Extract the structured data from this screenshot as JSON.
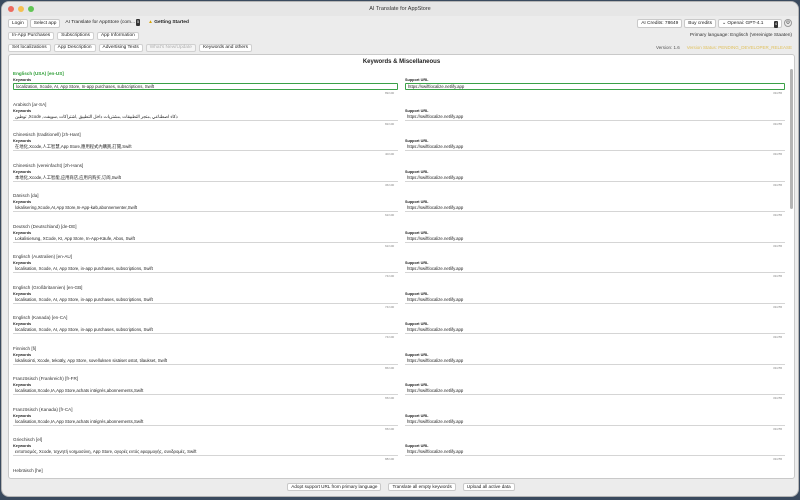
{
  "window": {
    "title": "AI Translate for AppStore"
  },
  "colors": {
    "close": "#ec6a5e",
    "minimize": "#f5bf4f",
    "zoom": "#61c554",
    "accent_green": "#2e9e36",
    "warn": "#e0c05c"
  },
  "toolbar": {
    "login_label": "Login",
    "select_app_label": "Select app",
    "app_name": "AI Translate for AppStore (com...",
    "app_badge": "5",
    "getting_started_label": "Getting Started",
    "credits": "AI Credits: 78649",
    "buy_credits_label": "Buy credits",
    "model_select": "Openai: GPT-4.1",
    "model_badge": "4"
  },
  "segments": {
    "items": [
      "In-App Purchases",
      "Subscriptions",
      "App Information"
    ],
    "primary_language": "Primary language: Englisch (Vereinigte Staaten)"
  },
  "tabs": {
    "items": [
      "Set localizations",
      "App Description",
      "Advertising Texts",
      "What's New/Update",
      "Keywords and others"
    ],
    "version": "Version: 1.6",
    "status": "Version Status: PENDING_DEVELOPER_RELEASE"
  },
  "main": {
    "title": "Keywords & Miscellaneous",
    "keywords_label": "Keywords",
    "support_label": "Support URL",
    "entries": [
      {
        "lang": "Englisch (USA) [en-US]",
        "keywords": "localization, Xcode, AI, App Store, In-app purchases, subscriptions, Swift",
        "kw_count": "89/100",
        "url": "https://swiftlocalize.netlify.app",
        "url_count": "33/255"
      },
      {
        "lang": "Arabisch [ar-SA]",
        "keywords": "توطين ,Xcode ,ذكاء اصطناعي ,متجر التطبيقات ,مشتريات داخل التطبيق ,اشتراكات ,سويفت",
        "kw_count": "82/100",
        "url": "https://swiftlocalize.netlify.app",
        "url_count": "33/255"
      },
      {
        "lang": "Chinesisch (traditionell) [zh-Hant]",
        "keywords": "在地化,Xcode,人工智慧,App Store,應用程式內購買,訂閱,Swift",
        "kw_count": "40/100",
        "url": "https://swiftlocalize.netlify.app",
        "url_count": "33/255"
      },
      {
        "lang": "Chinesisch (vereinfacht) [zh-Hans]",
        "keywords": "本地化,Xcode,人工智能,应用商店,应用内购买,订阅,Swift",
        "kw_count": "36/100",
        "url": "https://swiftlocalize.netlify.app",
        "url_count": "33/255"
      },
      {
        "lang": "Dänisch [da]",
        "keywords": "lokalisering,Xcode,AI,App Store,In-App-køb,abonnementer,Swift",
        "kw_count": "62/100",
        "url": "https://swiftlocalize.netlify.app",
        "url_count": "33/255"
      },
      {
        "lang": "Deutsch (Deutschland) [de-DE]",
        "keywords": "Lokalisierung, XCode, KI, App Store, In-App-Käufe, Abos, Swift",
        "kw_count": "62/100",
        "url": "https://swiftlocalize.netlify.app",
        "url_count": "33/255"
      },
      {
        "lang": "Englisch (Australien) [en-AU]",
        "keywords": "localisation, Xcode, AI, App Store, in-app purchases, subscriptions, Swift",
        "kw_count": "74/100",
        "url": "https://swiftlocalize.netlify.app",
        "url_count": "33/255"
      },
      {
        "lang": "Englisch (Großbritannien) [en-GB]",
        "keywords": "localisation, Xcode, AI, App Store, in-app purchases, subscriptions, Swift",
        "kw_count": "74/100",
        "url": "https://swiftlocalize.netlify.app",
        "url_count": "33/255"
      },
      {
        "lang": "Englisch (Kanada) [en-CA]",
        "keywords": "localization, Xcode, AI, App Store, in-app purchases, subscriptions, Swift",
        "kw_count": "74/100",
        "url": "https://swiftlocalize.netlify.app",
        "url_count": "33/255"
      },
      {
        "lang": "Finnisch [fi]",
        "keywords": "lokalisointi, Xcode, tekoäly, App Store, sovelluksen sisäiset ostot, tilaukset, Swift",
        "kw_count": "86/100",
        "url": "https://swiftlocalize.netlify.app",
        "url_count": "33/255"
      },
      {
        "lang": "Französisch (Frankreich) [fr-FR]",
        "keywords": "localisation,Xcode,IA,App Store,achats intégrés,abonnements,Swift",
        "kw_count": "65/100",
        "url": "https://swiftlocalize.netlify.app",
        "url_count": "33/255"
      },
      {
        "lang": "Französisch (Kanada) [fr-CA]",
        "keywords": "localisation,Xcode,IA,App Store,achats intégrés,abonnements,Swift",
        "kw_count": "65/100",
        "url": "https://swiftlocalize.netlify.app",
        "url_count": "33/255"
      },
      {
        "lang": "Griechisch [el]",
        "keywords": "εντοπισμός, Xcode, τεχνητή νοημοσύνη, App Store, αγορές εντός εφαρμογής, συνδρομές, Swift",
        "kw_count": "88/100",
        "url": "https://swiftlocalize.netlify.app",
        "url_count": "33/255"
      },
      {
        "lang": "Hebräisch [he]",
        "keywords": "",
        "kw_count": "",
        "url": "",
        "url_count": ""
      }
    ]
  },
  "bottom": {
    "adopt_label": "Adopt support URL from primary language",
    "translate_label": "Translate all empty keywords",
    "upload_label": "Upload all active data"
  }
}
